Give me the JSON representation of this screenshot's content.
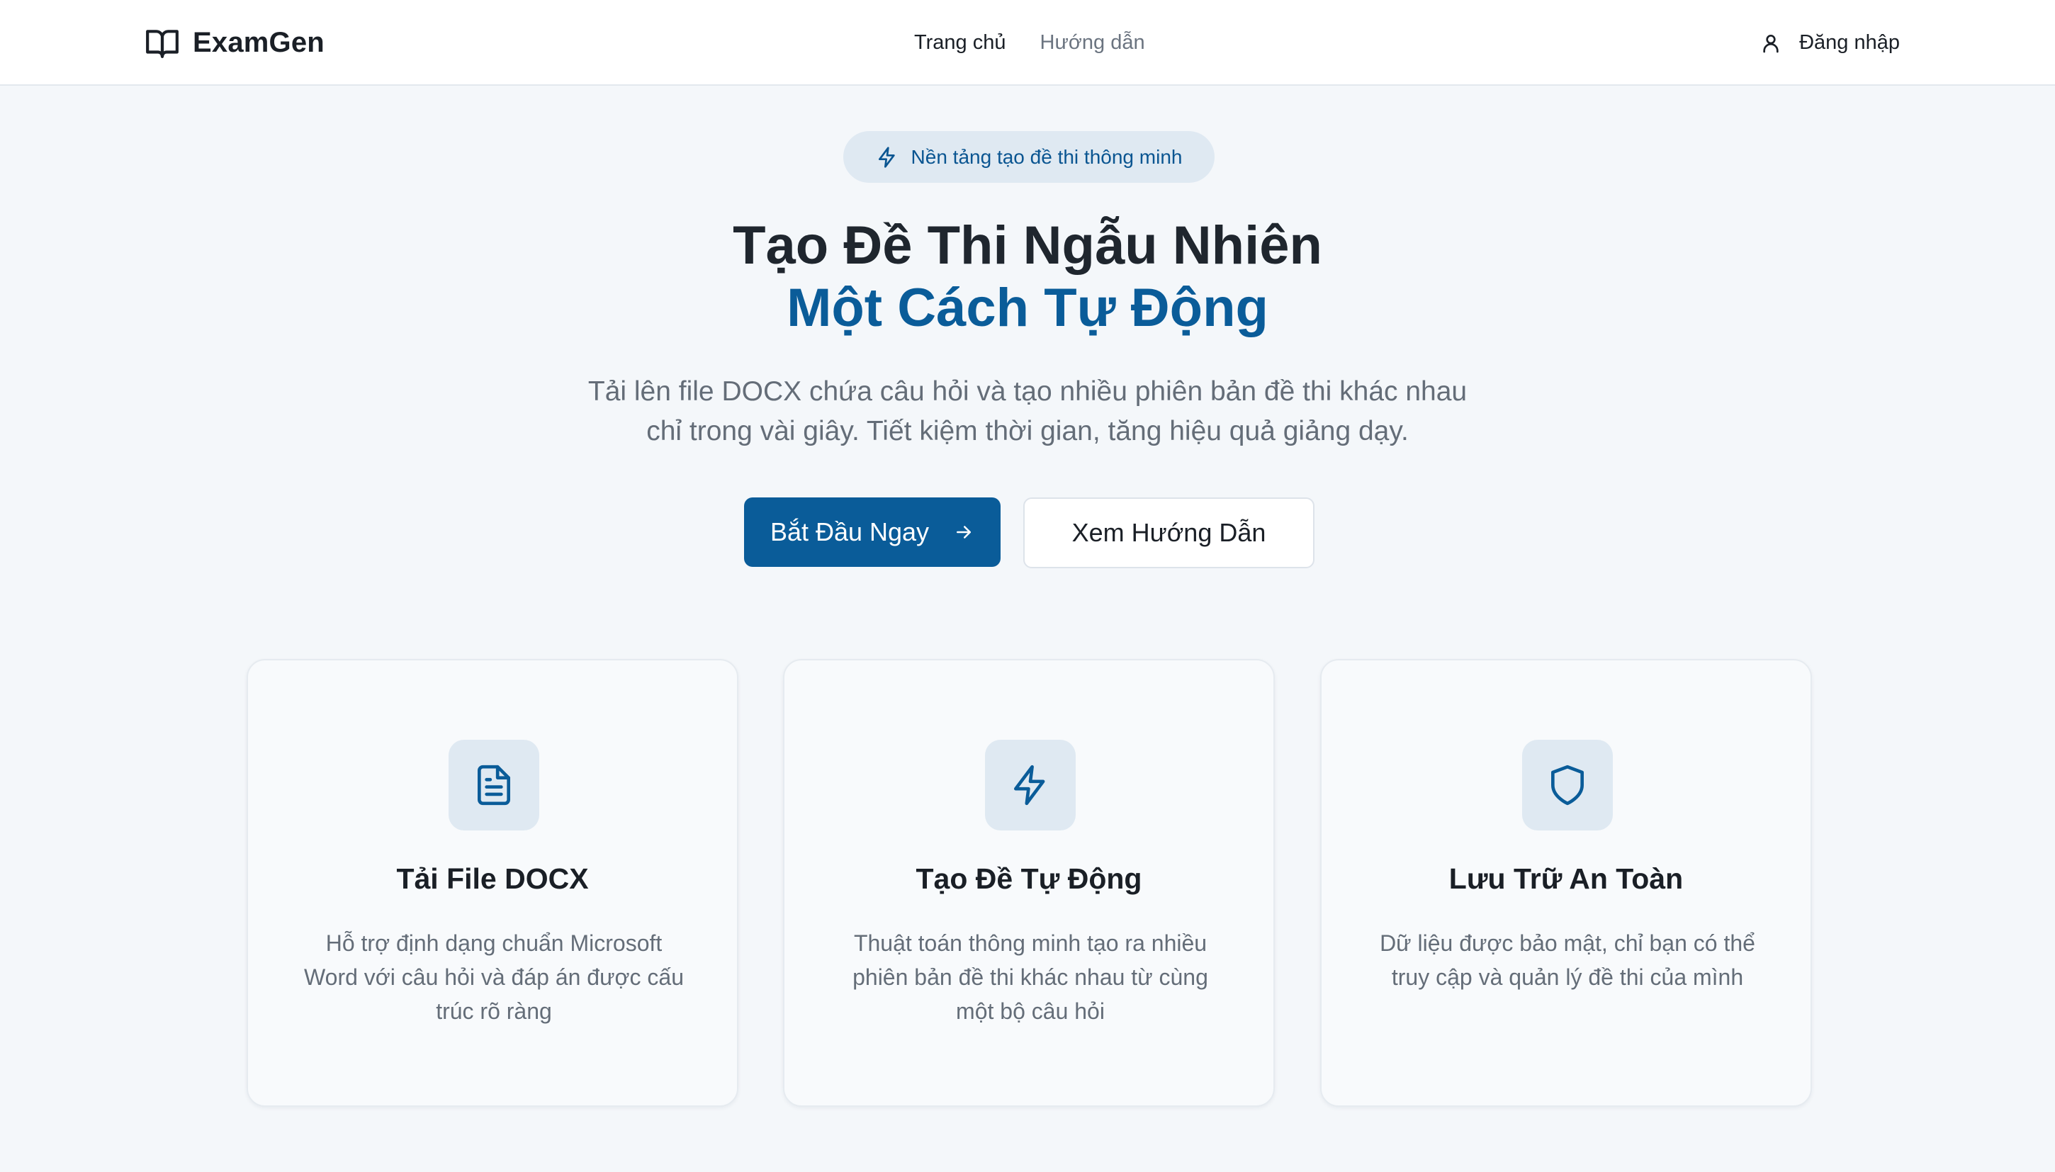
{
  "header": {
    "brand": "ExamGen",
    "nav": [
      {
        "label": "Trang chủ",
        "active": true
      },
      {
        "label": "Hướng dẫn",
        "active": false
      }
    ],
    "login_label": "Đăng nhập"
  },
  "hero": {
    "badge": "Nền tảng tạo đề thi thông minh",
    "title_line1": "Tạo Đề Thi Ngẫu Nhiên",
    "title_line2": "Một Cách Tự Động",
    "subtitle_line1": "Tải lên file DOCX chứa câu hỏi và tạo nhiều phiên bản đề thi khác nhau",
    "subtitle_line2": "chỉ trong vài giây. Tiết kiệm thời gian, tăng hiệu quả giảng dạy.",
    "primary_button": "Bắt Đầu Ngay",
    "secondary_button": "Xem Hướng Dẫn"
  },
  "features": [
    {
      "icon": "file-text-icon",
      "title": "Tải File DOCX",
      "desc_lines": [
        "Hỗ trợ định dạng chuẩn Microsoft",
        "Word với câu hỏi và đáp án được cấu",
        "trúc rõ ràng"
      ]
    },
    {
      "icon": "lightning-icon",
      "title": "Tạo Đề Tự Động",
      "desc_lines": [
        "Thuật toán thông minh tạo ra nhiều",
        "phiên bản đề thi khác nhau từ cùng",
        "một bộ câu hỏi"
      ]
    },
    {
      "icon": "shield-icon",
      "title": "Lưu Trữ An Toàn",
      "desc_lines": [
        "Dữ liệu được bảo mật, chỉ bạn có thể",
        "truy cập và quản lý đề thi của mình"
      ]
    }
  ],
  "colors": {
    "primary": "#0a5c99",
    "badge_bg": "#dfe9f2",
    "page_bg": "#f4f7fa"
  }
}
